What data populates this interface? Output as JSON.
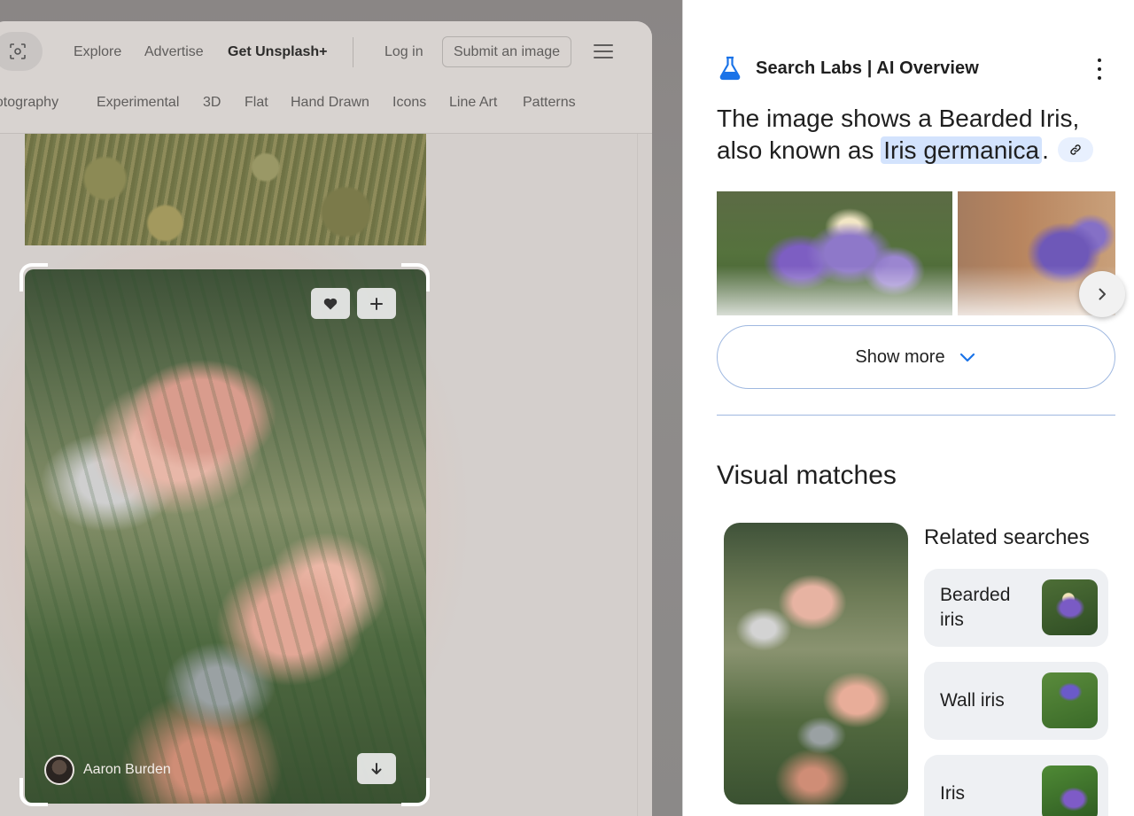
{
  "unsplash": {
    "nav": {
      "explore": "Explore",
      "advertise": "Advertise",
      "get_plus": "Get Unsplash+",
      "login": "Log in",
      "submit": "Submit an image"
    },
    "categories": [
      "hotography",
      "Experimental",
      "3D",
      "Flat",
      "Hand Drawn",
      "Icons",
      "Line Art",
      "Patterns"
    ],
    "photo": {
      "author": "Aaron Burden"
    }
  },
  "ai_overview": {
    "header_title": "Search Labs | AI Overview",
    "text_before": "The image shows a Bearded Iris, also known as ",
    "highlight": "Iris germanica",
    "text_after": ".",
    "show_more": "Show more"
  },
  "visual_matches": {
    "title": "Visual matches",
    "related_title": "Related searches",
    "related": [
      {
        "label": "Bearded iris"
      },
      {
        "label": "Wall iris"
      },
      {
        "label": "Iris"
      }
    ]
  },
  "colors": {
    "accent_blue": "#1a73e8",
    "highlight_bg": "#d3e3fd",
    "dim_overlay": "#8a8685"
  },
  "icons": [
    "lens-icon",
    "hamburger-icon",
    "heart-icon",
    "plus-icon",
    "download-icon",
    "flask-icon",
    "kebab-icon",
    "link-icon",
    "chevron-right-icon",
    "chevron-down-icon"
  ]
}
